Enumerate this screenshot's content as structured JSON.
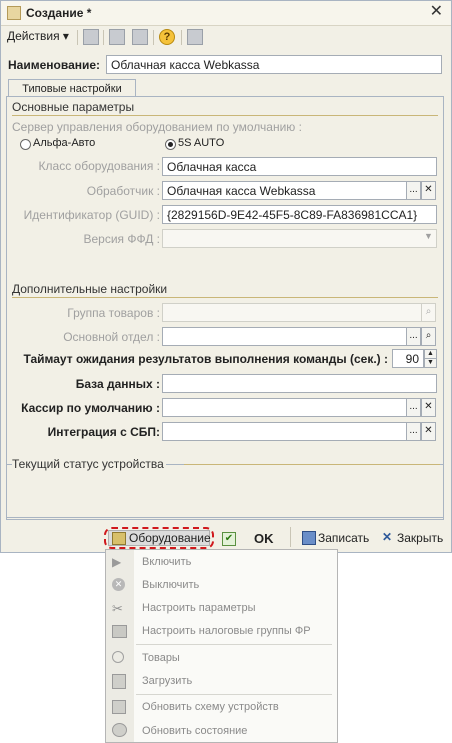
{
  "window": {
    "title": "Создание *"
  },
  "toolbar": {
    "actions_label": "Действия",
    "help": "?"
  },
  "name": {
    "label": "Наименование:",
    "value": "Облачная касса Webkassa"
  },
  "tab": {
    "label": "Типовые настройки"
  },
  "basic": {
    "title": "Основные параметры",
    "server_label": "Сервер управления оборудованием по умолчанию :",
    "radio1": "Альфа-Авто",
    "radio2": "5S AUTO",
    "class_label": "Класс оборудования :",
    "class_value": "Облачная касса",
    "handler_label": "Обработчик :",
    "handler_value": "Облачная касса Webkassa",
    "guid_label": "Идентификатор (GUID) :",
    "guid_value": "{2829156D-9E42-45F5-8C89-FA836981CCA1}",
    "ffd_label": "Версия ФФД :",
    "ffd_value": ""
  },
  "extra": {
    "title": "Дополнительные настройки",
    "group_label": "Группа товаров :",
    "dept_label": "Основной отдел :",
    "timeout_label": "Таймаут ожидания результатов выполнения команды (сек.) :",
    "timeout_value": "90",
    "db_label": "База данных :",
    "cashier_label": "Кассир по умолчанию :",
    "sbp_label": "Интеграция с СБП:"
  },
  "status": {
    "title": "Текущий статус устройства"
  },
  "bottom": {
    "equipment": "Оборудование",
    "ok": "OK",
    "save": "Записать",
    "close": "Закрыть"
  },
  "menu": [
    {
      "label": "Включить",
      "icon": "play-icon"
    },
    {
      "label": "Выключить",
      "icon": "stop-icon"
    },
    {
      "label": "Настроить параметры",
      "icon": "tools-icon"
    },
    {
      "label": "Настроить налоговые группы ФР",
      "icon": "tax-icon"
    },
    {
      "label": "Товары",
      "icon": "goods-icon"
    },
    {
      "label": "Загрузить",
      "icon": "upload-icon"
    },
    {
      "label": "Обновить схему устройств",
      "icon": "scheme-icon"
    },
    {
      "label": "Обновить состояние",
      "icon": "refresh-icon"
    }
  ],
  "colors": {
    "frame": "#a9b4c2",
    "highlight_dash": "#d0181c",
    "section_line": "#c9b678"
  }
}
